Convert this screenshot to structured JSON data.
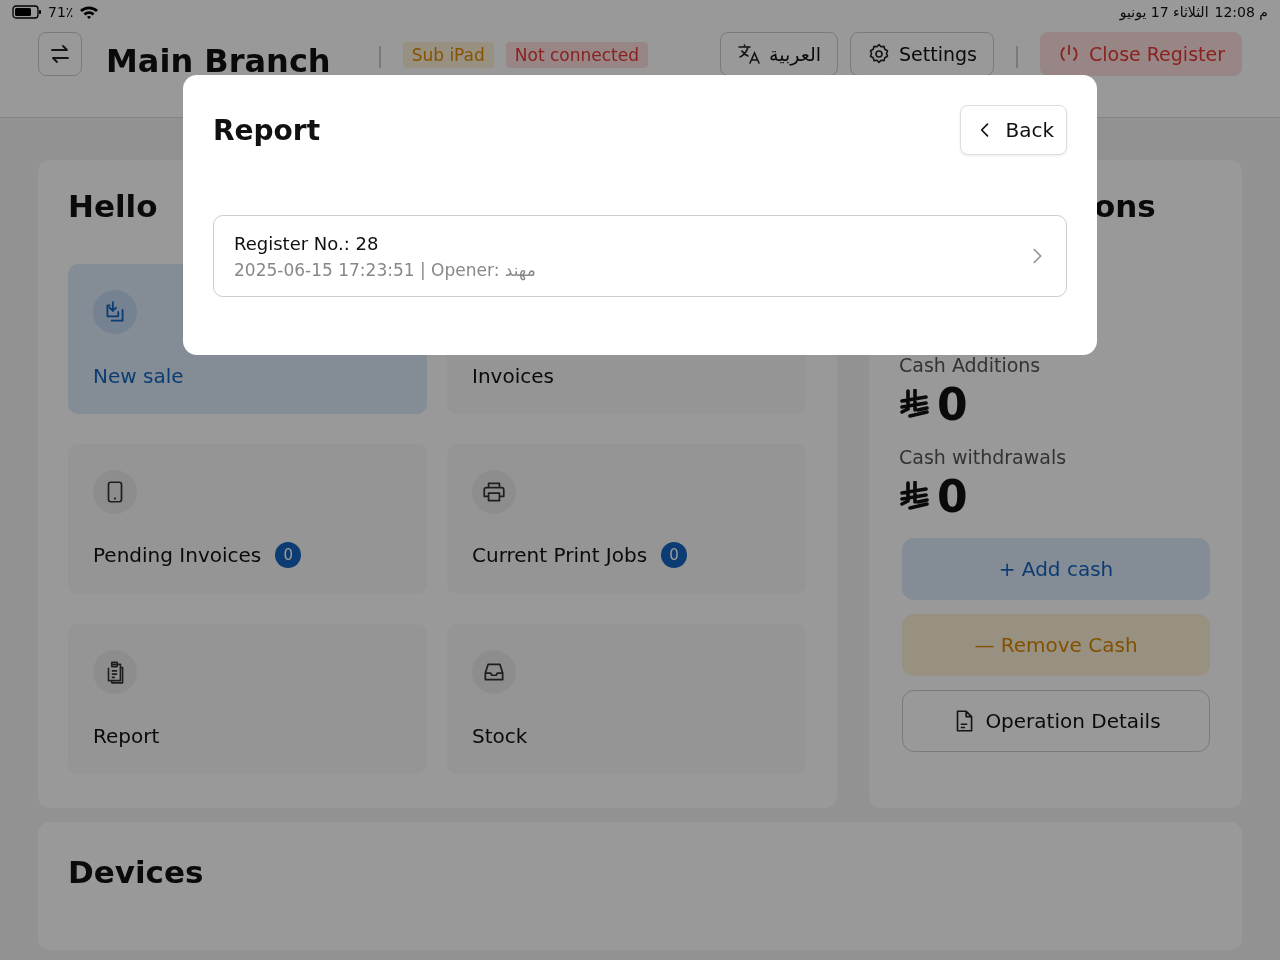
{
  "status_bar": {
    "battery": "71٪",
    "time": "12:08 م",
    "date": "الثلاثاء 17 يونيو"
  },
  "header": {
    "title": "Main Branch",
    "badges": [
      {
        "label": "Sub iPad",
        "kind": "warning"
      },
      {
        "label": "Not connected",
        "kind": "danger"
      }
    ],
    "buttons": [
      {
        "label": "العربية",
        "kind": "language"
      },
      {
        "label": "Settings",
        "kind": "settings"
      },
      {
        "label": "Close Register",
        "kind": "close"
      }
    ]
  },
  "greeting": "Hello",
  "tiles": [
    {
      "label": "New sale",
      "selected": true
    },
    {
      "label": "Invoices",
      "selected": false
    },
    {
      "label": "Pending Invoices",
      "selected": false,
      "count": "0"
    },
    {
      "label": "Current Print Jobs",
      "selected": false,
      "count": "0"
    },
    {
      "label": "Report",
      "selected": false
    },
    {
      "label": "Stock",
      "selected": false
    }
  ],
  "cash_panel": {
    "heading": "ons",
    "totals": [
      {
        "label": "Cash Additions",
        "amount": "0"
      },
      {
        "label": "Cash withdrawals",
        "amount": "0"
      }
    ],
    "buttons": [
      {
        "label": "Add cash",
        "glyph": "+",
        "kind": "add"
      },
      {
        "label": "Remove Cash",
        "glyph": "—",
        "kind": "remove"
      },
      {
        "label": "Operation Details",
        "kind": "details"
      }
    ]
  },
  "devices": {
    "title": "Devices"
  },
  "modal": {
    "title": "Report",
    "back": "Back",
    "registers": [
      {
        "title": "Register No.: 28",
        "subtitle": "2025-06-15 17:23:51 | Opener: مهند"
      }
    ]
  }
}
